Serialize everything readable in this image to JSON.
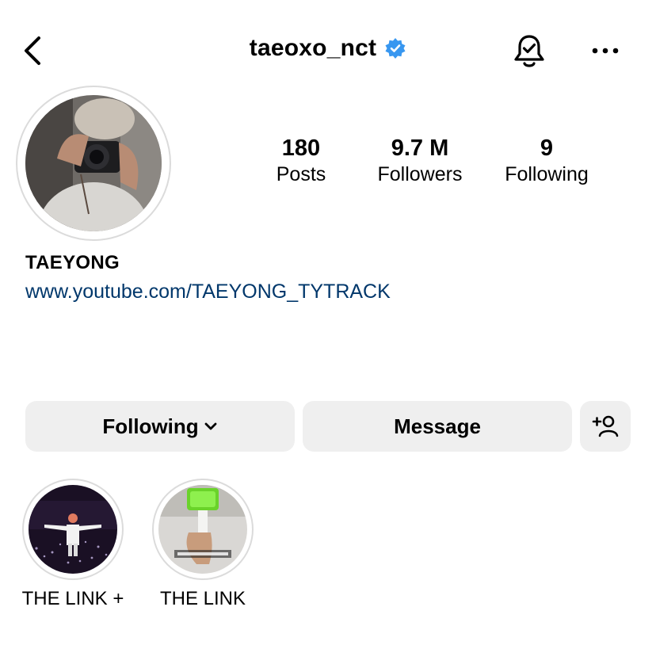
{
  "header": {
    "username": "taeoxo_nct",
    "verified_icon": "verified-badge-icon",
    "back_icon": "chevron-left-icon",
    "bell_icon": "bell-check-icon",
    "more_icon": "more-dots-icon"
  },
  "profile": {
    "display_name": "TAEYONG",
    "link": "www.youtube.com/TAEYONG_TYTRACK"
  },
  "stats": [
    {
      "count": "180",
      "label": "Posts"
    },
    {
      "count": "9.7 M",
      "label": "Followers"
    },
    {
      "count": "9",
      "label": "Following"
    }
  ],
  "actions": {
    "following_label": "Following",
    "message_label": "Message",
    "add_icon": "person-add-icon"
  },
  "highlights": [
    {
      "label": "THE LINK +"
    },
    {
      "label": "THE LINK"
    }
  ],
  "colors": {
    "link": "#00376b",
    "verified": "#3897f0",
    "button_bg": "#efefef"
  }
}
